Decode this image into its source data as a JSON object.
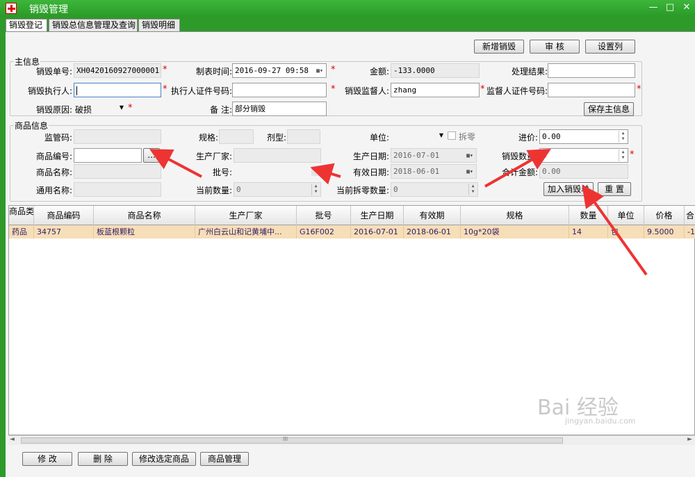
{
  "window": {
    "title": "销毁管理",
    "minimize": "—",
    "maximize": "□",
    "close": "✕"
  },
  "tabs": [
    {
      "label": "销毁登记"
    },
    {
      "label": "销毁总信息管理及查询"
    },
    {
      "label": "销毁明细"
    }
  ],
  "toolbar": {
    "new_label": "新增销毁",
    "audit_label": "审 核",
    "columns_label": "设置列"
  },
  "main_info": {
    "title": "主信息",
    "doc_no": {
      "label": "销毁单号:",
      "value": "XH0420160927000001"
    },
    "created_time": {
      "label": "制表时间:",
      "value": "2016-09-27 09:58"
    },
    "amount": {
      "label": "金额:",
      "value": "-133.0000"
    },
    "result": {
      "label": "处理结果:",
      "value": ""
    },
    "executor": {
      "label": "销毁执行人:",
      "value": ""
    },
    "executor_id": {
      "label": "执行人证件号码:",
      "value": ""
    },
    "supervisor": {
      "label": "销毁监督人:",
      "value": "zhang"
    },
    "supervisor_id": {
      "label": "监督人证件号码:",
      "value": ""
    },
    "reason": {
      "label": "销毁原因:",
      "value": "破损"
    },
    "note": {
      "label": "备 注:",
      "value": "部分销毁"
    },
    "save_label": "保存主信息"
  },
  "goods_info": {
    "title": "商品信息",
    "supervise_code": {
      "label": "监管码:",
      "value": ""
    },
    "spec": {
      "label": "规格:",
      "value": ""
    },
    "dosage": {
      "label": "剂型:",
      "value": ""
    },
    "unit": {
      "label": "单位:",
      "value": ""
    },
    "split_label": "拆零",
    "purchase_price": {
      "label": "进价:",
      "value": "0.00"
    },
    "goods_no": {
      "label": "商品编号:",
      "value": "",
      "browse": "..."
    },
    "manufacturer": {
      "label": "生产厂家:",
      "value": ""
    },
    "production_date": {
      "label": "生产日期:",
      "value": "2016-07-01"
    },
    "destroy_qty": {
      "label": "销毁数量:",
      "value": "0"
    },
    "goods_name": {
      "label": "商品名称:",
      "value": ""
    },
    "batch_no": {
      "label": "批号:",
      "value": ""
    },
    "expiry_date": {
      "label": "有效日期:",
      "value": "2018-06-01"
    },
    "total_amount": {
      "label": "合计金额:",
      "value": "0.00"
    },
    "common_name": {
      "label": "通用名称:",
      "value": ""
    },
    "current_qty": {
      "label": "当前数量:",
      "value": "0"
    },
    "current_split_qty": {
      "label": "当前拆零数量:",
      "value": "0"
    },
    "add_label": "加入销毁单",
    "reset_label": "重 置"
  },
  "table": {
    "columns": [
      "商品类型",
      "商品编码",
      "商品名称",
      "生产厂家",
      "批号",
      "生产日期",
      "有效期",
      "规格",
      "数量",
      "单位",
      "价格",
      "合"
    ],
    "rows": [
      [
        "药品",
        "34757",
        "板蓝根颗粒",
        "广州白云山和记黄埔中...",
        "G16F002",
        "2016-07-01",
        "2018-06-01",
        "10g*20袋",
        "14",
        "包",
        "9.5000",
        "-1"
      ]
    ]
  },
  "scrollbar": {
    "left": "◄",
    "right": "►",
    "grip": "III"
  },
  "bottom": {
    "edit_label": "修 改",
    "delete_label": "删 除",
    "edit_selected_label": "修改选定商品",
    "goods_mgmt_label": "商品管理"
  },
  "watermark": {
    "brand": "Bai 经验",
    "url": "jingyan.baidu.com"
  }
}
